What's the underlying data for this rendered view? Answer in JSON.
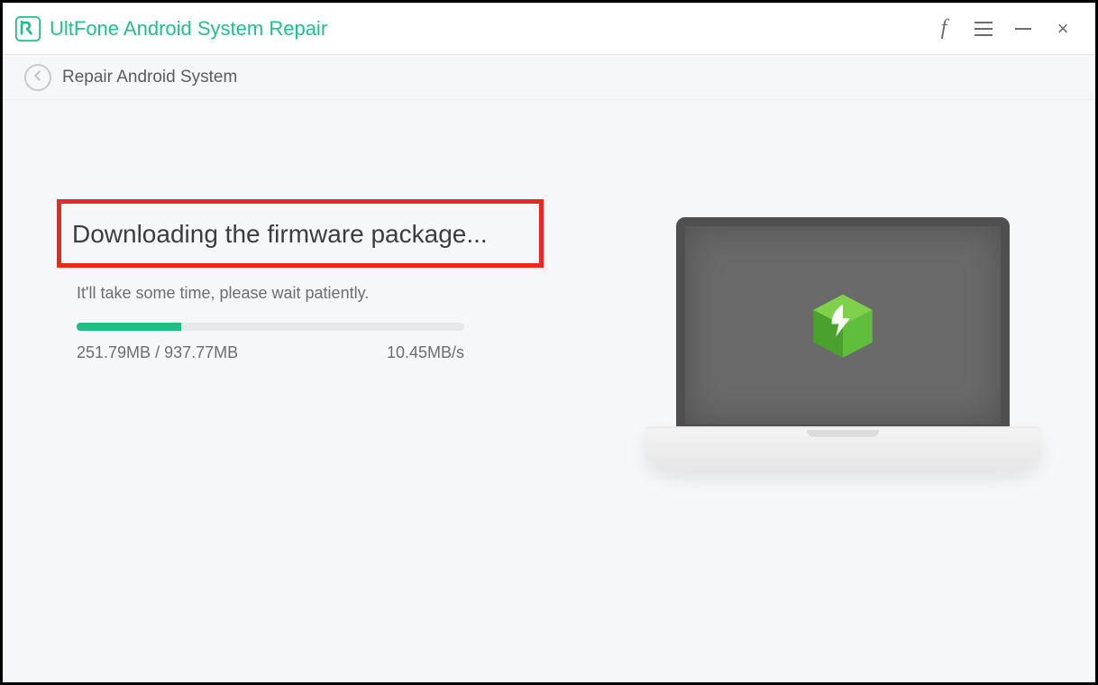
{
  "window": {
    "app_title": "UltFone Android System Repair",
    "breadcrumb": "Repair Android System"
  },
  "titlebar_icons": {
    "facebook": "f",
    "menu": "menu",
    "minimize": "minimize",
    "close": "×"
  },
  "download": {
    "headline": "Downloading the firmware package...",
    "subtext": "It'll take some time, please wait patiently.",
    "progress_percent": 27,
    "downloaded_mb": "251.79MB",
    "total_mb": "937.77MB",
    "separator": " / ",
    "speed": "10.45MB/s"
  },
  "colors": {
    "accent": "#1fbf84",
    "highlight_border": "#e8291f"
  }
}
